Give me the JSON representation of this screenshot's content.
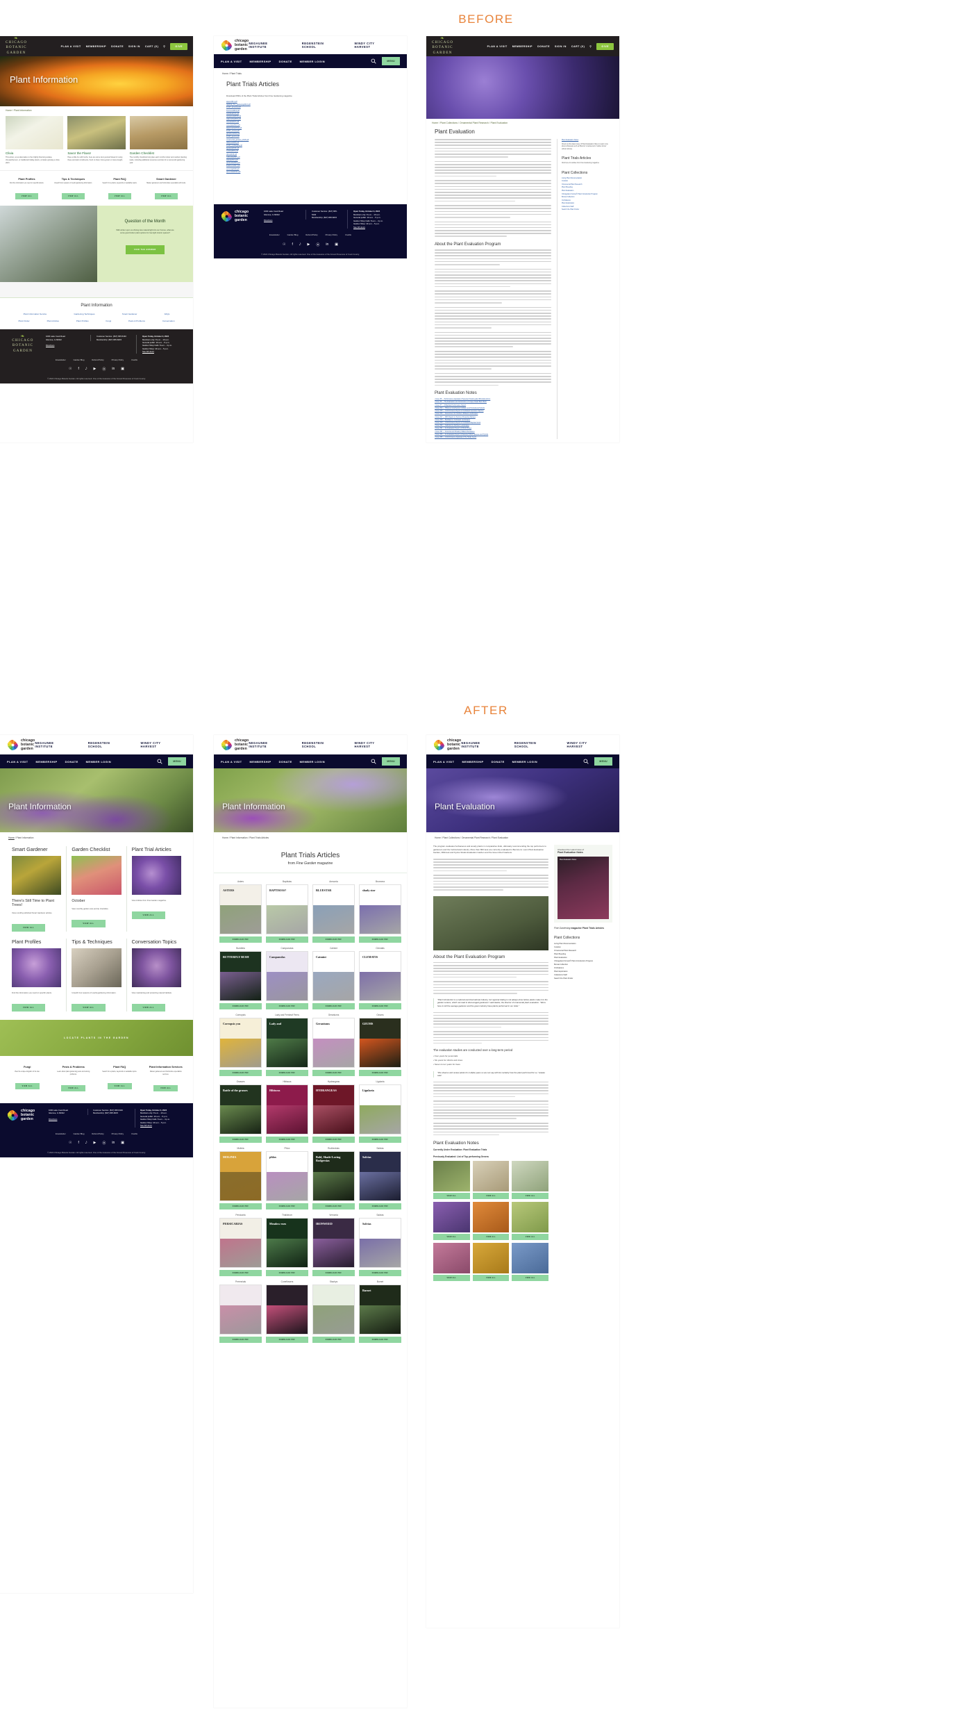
{
  "labels": {
    "before": "BEFORE",
    "after": "AFTER"
  },
  "brand": {
    "old_logo_lines": [
      "CHICAGO",
      "BOTANIC",
      "GARDEN"
    ],
    "new_logo_lines": [
      "chicago",
      "botanic",
      "garden"
    ],
    "accent_green": "#8fd6a0",
    "navy": "#0b0b2e",
    "orange": "#e8833a"
  },
  "old_site": {
    "nav": [
      "PLAN A VISIT",
      "MEMBERSHIP",
      "DONATE",
      "SIGN IN",
      "CART (0)"
    ],
    "nav_cta": "GIVE"
  },
  "new_site": {
    "top_links": [
      "NEGAUNEE INSTITUTE",
      "REGENSTEIN SCHOOL",
      "WINDY CITY HARVEST"
    ],
    "bar_links": [
      "PLAN A VISIT",
      "MEMBERSHIP",
      "DONATE",
      "MEMBER LOGIN"
    ],
    "menu_label": "MENU",
    "search_icon": "search-icon"
  },
  "before": {
    "panel1": {
      "hero_title": "Plant Information",
      "breadcrumb": "Home / Plant Information",
      "cards": [
        {
          "title": "Clivia",
          "desc": "This winter, up an alternative to the brightly blooming azalea, chrysanthemum, or traditional holiday plants, consider growing a clivia plant."
        },
        {
          "title": "Savor the Flavor",
          "desc": "Have a little fun with herbs, here are some do-it-yourself ideas for using these aromatic condiments, fresh or dried, home-grown or store-bought."
        },
        {
          "title": "Garden Checklist",
          "desc": "The monthly checklists help plan each months indoor and outdoor planting tasks, including additional resources and tips for a successful gardening year."
        }
      ],
      "tiles": [
        {
          "title": "Plant Profiles",
          "desc": "Find the information you need on specific plants.",
          "btn": "VIEW ALL"
        },
        {
          "title": "Tips & Techniques",
          "desc": "Unearth four seasons of useful gardening information.",
          "btn": "VIEW ALL"
        },
        {
          "title": "Plant FAQ",
          "desc": "Search for a plants, keywords or available topics.",
          "btn": "VIEW ALL"
        },
        {
          "title": "Smart Gardener",
          "desc": "Master gardeners and horticulture specialists with tools.",
          "btn": "VIEW ALL"
        }
      ],
      "qotm": {
        "title": "Question of the Month",
        "desc": "With winter upon us shining less natural light into our homes, what are some good indoor plant options for low-light interior spaces?",
        "btn": "FIND THE ANSWER"
      },
      "index": {
        "title": "Plant Information",
        "row1": [
          "Plant Information Service",
          "Gardening Techniques",
          "Smart Gardener",
          "FAQs"
        ],
        "row2": [
          "Plant Finder",
          "Plant Articles",
          "Plant Profiles",
          "Fungi",
          "Pests & Problems",
          "Conservation"
        ]
      },
      "footer": {
        "address1": "1000 Lake Cook Road",
        "address2": "Glencoe, IL 60022",
        "directions": "Directions",
        "cs_title": "Customer Service: (847) 835-5440",
        "cs_sub": "Membership: (847) 835-8215",
        "hours_title": "Open Today, October 3, 2024",
        "hours1": "Members only: 8 a.m. - 10 a.m.",
        "hours2": "General public: 10 a.m. - 5 p.m.",
        "hours3": "Garden Shop Café: 8 a.m. - 4 p.m.",
        "hours4": "Garden Shop: 10 a.m. - 5 p.m.",
        "hours_link": "See All Hours",
        "links": [
          "Enewsletter",
          "Garden Blog",
          "Refund Policy",
          "Privacy Policy",
          "Credits"
        ],
        "copyright": "© 2024 Chicago Botanic Garden. All rights reserved. One of the treasures of the Forest Preserves of Cook County."
      }
    },
    "panel2": {
      "title": "Plant Trials Articles",
      "breadcrumb": "Home / Plant Trials",
      "intro": "Download PDFs of the Plant Trials Articles from Fine Gardening magazine",
      "links": [
        "asters2011.pdf",
        "baptisia_fine_gardening2013.pdf",
        "FnGP_amsonia.pdf",
        "brunnera2014.pdf",
        "buddleia2010.pdf",
        "campanula2014.pdf",
        "calamintha2016.pdf",
        "clematis2017.pdf",
        "coreopsis2012.pdf",
        "ladysmantle2012.pdf",
        "FnGP_cornus.pdf",
        "geranium2011.pdf",
        "FnGP_geums.pdf",
        "ornamental_grasses_2018.pdf",
        "hibiscus2015.pdf",
        "FnGP_hydrangea.pdf",
        "liguliaria2016.pdf",
        "molinia2019.pdf",
        "phlox2015.pdf",
        "rudbeckia2015.pdf",
        "salvias2013.pdf",
        "persicaria2019.pdf",
        "thalictrum2017.pdf",
        "vernonia2018.pdf",
        "perennials2012.pdf"
      ]
    },
    "panel3": {
      "hero_title": "Plant Evaluation",
      "breadcrumb": "Home / Plant Collections / Ornamental Plant Research / Plant Evaluation",
      "title": "Plant Evaluation",
      "sidebar_note": "Check out the latest issue of Plant Evaluation Notes to learn more about wholesale such as Bloomin' smartsensors' Golden Arrow' (shown above).",
      "sidebar_title": "Plant Trials Articles",
      "sidebar_link": "Click here for articles from Fine Gardening magazine.",
      "collections_title": "Plant Collections",
      "collections": [
        "Living Plant Documentation",
        "Curation",
        "Ornamental Plant Research",
        "Plant Breeding",
        "Plant Evaluation",
        "Chicagoland Grows® Plant Introduction Program",
        "Bonsai Collection",
        "Orchidarium",
        "Plant Exploration",
        "Collections Staff",
        "Search the Plant Finder"
      ],
      "section2_title": "About the Plant Evaluation Program",
      "section3_title": "Plant Evaluation Notes",
      "notes": [
        "Issue #5 — Performance Appraisal of Selected Small-Leafed Rhododendrons",
        "Issue #6 — The Evaluation and Introduction of Unique Dwarf Birch Birch",
        "Issue #7 — A Baptisia Performance Report",
        "Issue #14 — Hibiscus moscheutos Cultivars and Horticultural Hybrids",
        "Issue #15 — A Performance Report of Cultivated Geranium Species",
        "Issue #16 — Assessment for Northern Midwest Landscapes",
        "Issue #17 — With Report on Summer Flowering Spiraea",
        "Issue #18 — Buddleia for Cultivated Landscapes",
        "Issue #19 — A Performance Report of Cultivated Baptisia Stock",
        "Issue #20 — Calmints for Northern Landscapes",
        "Issue #21 — An Evaluation Report of Shrub Roses",
        "Issue #31 — Amsonia and Powdery Mildew Resistance",
        "Issue #33 — An Evaluation Report of Selected Shrub Species and Hybrids",
        "Issue #35 — A Performance Appraisal of the Hardy Geum"
      ]
    }
  },
  "after": {
    "panel1": {
      "hero_title": "Plant Information",
      "breadcrumb_home": "Home",
      "breadcrumb_rest": "/ Plant Information",
      "cards_row1": [
        {
          "title": "Smart Gardener",
          "sub": "There's Still Time to Plant Trees!",
          "desc": "View monthly published Smart Gardener articles.",
          "btn": "VIEW ALL"
        },
        {
          "title": "Garden Checklist",
          "sub": "October",
          "desc": "View monthly garden care and tip checklists.",
          "btn": "VIEW ALL"
        },
        {
          "title": "Plant Trial Articles",
          "sub": "",
          "desc": "View Articles from Fine Garden magazine.",
          "btn": "VIEW ALL"
        }
      ],
      "cards_row2": [
        {
          "title": "Plant Profiles",
          "desc": "Find the information you need on specific plants.",
          "btn": "VIEW ALL"
        },
        {
          "title": "Tips & Techniques",
          "desc": "Unearth four seasons of useful gardening information.",
          "btn": "VIEW ALL"
        },
        {
          "title": "Conversation Topics",
          "desc": "View maintaining and protecting natural habitats.",
          "btn": "VIEW ALL"
        }
      ],
      "banner": "LOCATE PLANTS IN THE GARDEN",
      "tiles": [
        {
          "title": "Fungi",
          "desc": "View the unique kingdom of its own.",
          "btn": "VIEW ALL"
        },
        {
          "title": "Pests & Problems",
          "desc": "Learn about plant gardening pests and solving problems.",
          "btn": "VIEW ALL"
        },
        {
          "title": "Plant FAQ",
          "desc": "Search for a plants, keywords or available topics.",
          "btn": "VIEW ALL"
        },
        {
          "title": "Plant Information Services",
          "desc": "Master gardeners and horticulture specialists services.",
          "btn": "VIEW ALL"
        }
      ],
      "footer": {
        "address1": "1000 Lake Cook Road",
        "address2": "Glencoe, IL 60022",
        "directions": "Directions",
        "cs_title": "Customer Service: (847) 835-5440",
        "cs_sub": "Membership: (847) 835-8215",
        "hours_title": "Open Today, October 3, 2024",
        "hours1": "Members only: 8 a.m. - 10 a.m.",
        "hours2": "General public: 10 a.m. - 5 p.m.",
        "hours3": "Garden Shop Café: 8 a.m. - 4 p.m.",
        "hours4": "Garden Shop: 10 a.m. - 5 p.m.",
        "hours_link": "See All Hours",
        "links": [
          "Enewsletter",
          "Garden Blog",
          "Refund Policy",
          "Privacy Policy",
          "Credits"
        ],
        "copyright": "© 2024 Chicago Botanic Garden. All rights reserved. One of the treasures of the Forest Preserves of Cook County."
      }
    },
    "panel2": {
      "hero_title": "Plant Information",
      "breadcrumb": "Home / Plant Information / Plant Trials Articles",
      "title": "Plant Trials Articles",
      "subtitle_pre": "from ",
      "subtitle_em": "Fine Garden",
      "subtitle_post": " magazine",
      "download_label": "DOWNLOAD PDF",
      "items": [
        {
          "label": "Asters",
          "cover_title": "ASTERS",
          "c1": "#f3f0e8",
          "c2": "#8fa27a"
        },
        {
          "label": "Baptisias",
          "cover_title": "BAPTISIAS?",
          "c1": "#ffffff",
          "c2": "#b9c9a7"
        },
        {
          "label": "Amsonia",
          "cover_title": "BLUESTAR",
          "c1": "#ffffff",
          "c2": "#8aa0b8"
        },
        {
          "label": "Brunnera",
          "cover_title": "shady star",
          "c1": "#ffffff",
          "c2": "#7b6fae"
        },
        {
          "label": "Buddleia",
          "cover_title": "BUTTERFLY BUSH",
          "c1": "#1d3320",
          "c2": "#7a5f90"
        },
        {
          "label": "Campanulas",
          "cover_title": "Campanulas",
          "c1": "#ece7f2",
          "c2": "#9d8fc4"
        },
        {
          "label": "Calmint",
          "cover_title": "Catmint",
          "c1": "#ffffff",
          "c2": "#9aa8c0"
        },
        {
          "label": "Clematis",
          "cover_title": "CLEMATIS",
          "c1": "#ffffff",
          "c2": "#7e6fa8"
        },
        {
          "label": "Coreopsis",
          "cover_title": "Coreopsis you",
          "c1": "#f6efd8",
          "c2": "#e0b43c"
        },
        {
          "label": "Lady and Fernleaf Ferns",
          "cover_title": "Lady and",
          "c1": "#1f3a24",
          "c2": "#4f7b48"
        },
        {
          "label": "Geraniums",
          "cover_title": "Geraniums",
          "c1": "#ffffff",
          "c2": "#c48fc0"
        },
        {
          "label": "Geums",
          "cover_title": "GEUMS",
          "c1": "#2a2f1e",
          "c2": "#d4561f"
        },
        {
          "label": "Grasses",
          "cover_title": "Battle of the grasses",
          "c1": "#22341f",
          "c2": "#6a8a4e"
        },
        {
          "label": "Hibiscus",
          "cover_title": "Hibiscus",
          "c1": "#8d1b4b",
          "c2": "#b23a6b"
        },
        {
          "label": "Hydrangeas",
          "cover_title": "HYDRANGEAS",
          "c1": "#6e1728",
          "c2": "#a94f63"
        },
        {
          "label": "Ligularia",
          "cover_title": "Ligularia",
          "c1": "#ffffff",
          "c2": "#8faa5e"
        },
        {
          "label": "Molinia",
          "cover_title": "MOLINIA",
          "c1": "#d8a33a",
          "c2": "#8a6e2c"
        },
        {
          "label": "Phlox",
          "cover_title": "phlox",
          "c1": "#ffffff",
          "c2": "#b98fc0"
        },
        {
          "label": "Rudbeckias",
          "cover_title": "Bold, Shade-Loving Rodgersias",
          "c1": "#1e2b1a",
          "c2": "#5c7a4a"
        },
        {
          "label": "Salvias",
          "cover_title": "Salvias",
          "c1": "#2a2d4a",
          "c2": "#6a6fa0"
        },
        {
          "label": "Persicaria",
          "cover_title": "PERSICARIAS",
          "c1": "#f2efe6",
          "c2": "#c0748c"
        },
        {
          "label": "Thalictrum",
          "cover_title": "Meadow rues",
          "c1": "#17331c",
          "c2": "#4d7a4a"
        },
        {
          "label": "Vernonia",
          "cover_title": "IRONWEED",
          "c1": "#3a2a44",
          "c2": "#8a5f9c"
        },
        {
          "label": "Salvias",
          "cover_title": "Salvias",
          "c1": "#ffffff",
          "c2": "#7a6fa8"
        },
        {
          "label": "Perennials",
          "cover_title": "",
          "c1": "#f0e9ee",
          "c2": "#c98fa8"
        },
        {
          "label": "Coneflowers",
          "cover_title": "",
          "c1": "#2a1f2a",
          "c2": "#c4507a"
        },
        {
          "label": "Stachys",
          "cover_title": "",
          "c1": "#e8efe2",
          "c2": "#8fa27a"
        },
        {
          "label": "Burnet",
          "cover_title": "Burnet",
          "c1": "#1f2b1a",
          "c2": "#5c7a4a"
        }
      ]
    },
    "panel3": {
      "hero_title": "Plant Evaluation",
      "breadcrumb": "Home / Plant Collections / Ornamental Plant Research / Plant Evaluation",
      "intro": "The program evaluates herbaceous and woody plants in comparative trials, ultimately recommending the top performers to gardeners and the horticultural industry. More than 800 taxa are currently evaluated in Bernice E. Lavin Plant Evaluation Garden, Millcreek and Kyoko Straits Evaluation Garden and the Green Roof Gardens.",
      "quote": "\"Plant introduction is a national and international industry, but regional trialing is not always done before plants make it to the garden centers, which can lead to discouraged gardeners\" said Hawke, the director of ornamental plant evaluation. \"We're here to tell the average gardener and the green industry have plants performed in our trials.\"",
      "quote2": "\"We observe and review plants for multiple years so we can say with far certainty how the plant performed for us,\" Hawke said.",
      "studies_title": "The evaluation studies are conducted over a long-term period",
      "studies": [
        "Four years for perennials",
        "Six years for shrubs and vines",
        "Seven to ten years for trees"
      ],
      "sidebar": {
        "cta_title": "Checkout the Latest Issue of",
        "cta_bold": "Plant Evaluation Notes",
        "mag_label": "Plant Evaluation Notes",
        "caption_pre": "Fine Gardening",
        "caption_bold": " magazine Plant Trials Articles",
        "collections_title": "Plant Collections",
        "collections": [
          "Living Plant Documentation",
          "Curation",
          "Ornamental Plant Research",
          "Plant Breeding",
          "Plant Evaluation",
          "Chicagoland Grows® Plant Introduction Program",
          "Bonsai Collection",
          "Orchidarium",
          "Plant Exploration",
          "Collections Staff",
          "Search the Plant Finder"
        ]
      },
      "section2_title": "About the Plant Evaluation Program",
      "section3_title": "Plant Evaluation Notes",
      "current_label": "Currently Under Evaluation: Plant Evaluation Trials",
      "previous_label": "Previously Evaluated: List of Top performing Genera",
      "grid_btn": "VIEW ALL"
    }
  }
}
